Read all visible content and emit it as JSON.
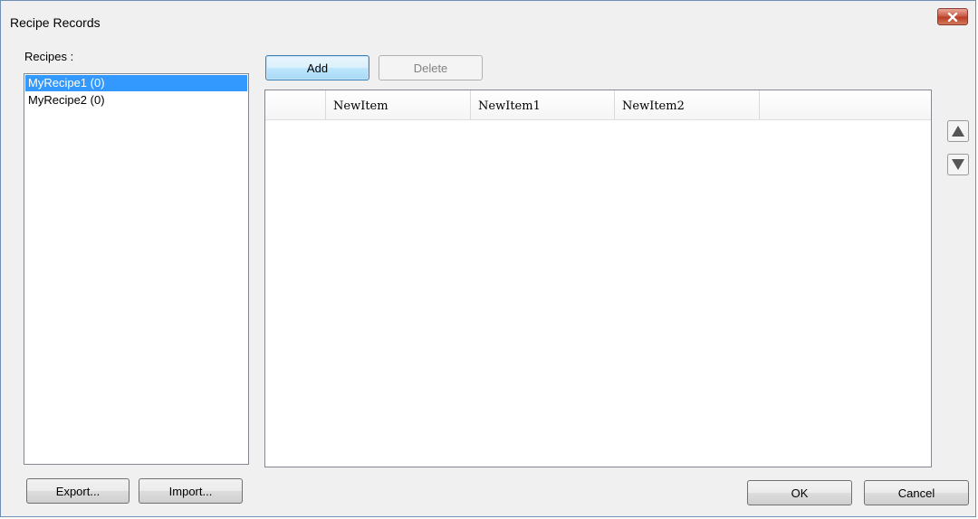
{
  "window": {
    "title": "Recipe Records"
  },
  "recipes": {
    "label": "Recipes :",
    "items": [
      "MyRecipe1 (0)",
      "MyRecipe2 (0)"
    ],
    "selected_index": 0
  },
  "toolbar": {
    "add_label": "Add",
    "delete_label": "Delete"
  },
  "grid": {
    "columns": [
      "",
      "NewItem",
      "NewItem1",
      "NewItem2",
      ""
    ],
    "rows": []
  },
  "footer": {
    "export_label": "Export...",
    "import_label": "Import...",
    "ok_label": "OK",
    "cancel_label": "Cancel"
  },
  "icons": {
    "close": "close-icon",
    "move_up": "triangle-up-icon",
    "move_down": "triangle-down-icon"
  },
  "colors": {
    "selection": "#3399ff",
    "close_button": "#c8553f",
    "window_background": "#f0f0f0"
  }
}
